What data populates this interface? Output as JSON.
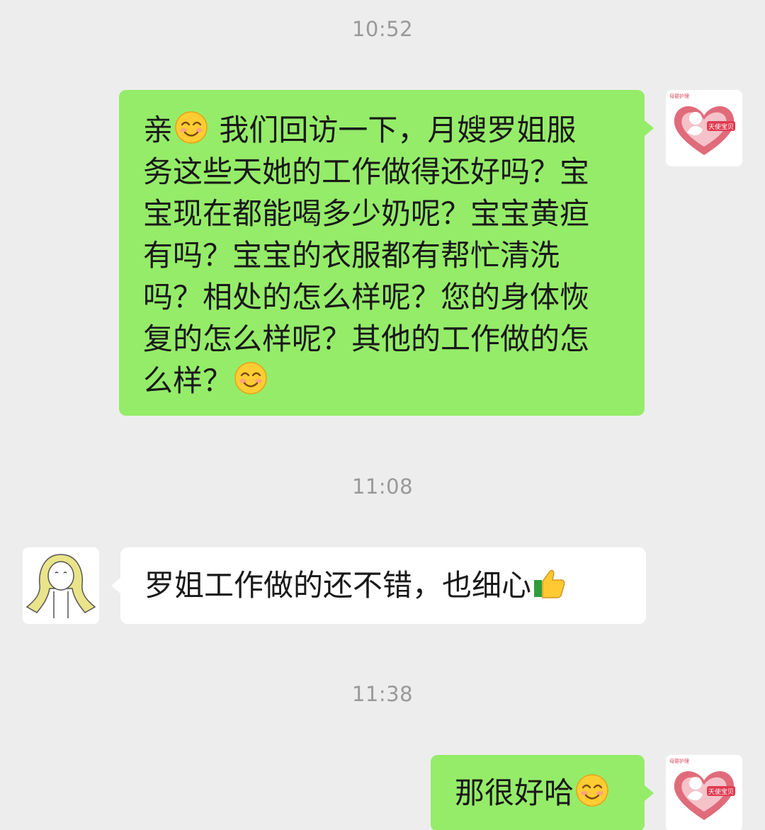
{
  "timestamps": {
    "t1": "10:52",
    "t2": "11:08",
    "t3": "11:38"
  },
  "messages": {
    "m1": {
      "lines": [
        "亲",
        "我们回访一下，月嫂罗姐服",
        "务这些天她的工作做得还好吗？宝",
        "宝现在都能喝多少奶呢？宝宝黄疸",
        "有吗？宝宝的衣服都有帮忙清洗",
        "吗？相处的怎么样呢？您的身体恢",
        "复的怎么样呢？其他的工作做的怎",
        "么样？"
      ],
      "emojis": [
        "smile-emoji",
        "smile-emoji"
      ]
    },
    "m2": {
      "text": "罗姐工作做的还不错，也细心",
      "emoji": "thumbs-up-emoji"
    },
    "m3": {
      "text": "那很好哈",
      "emoji": "smile-emoji"
    }
  },
  "avatars": {
    "self": {
      "top_text": "母婴护理",
      "logo_text": "天使宝贝",
      "color": "#d9475b"
    },
    "contact": {
      "icon": "cartoon-person-with-hood"
    }
  },
  "colors": {
    "background": "#ededed",
    "outgoing_bubble": "#95ec69",
    "incoming_bubble": "#ffffff",
    "timestamp": "#999999"
  }
}
